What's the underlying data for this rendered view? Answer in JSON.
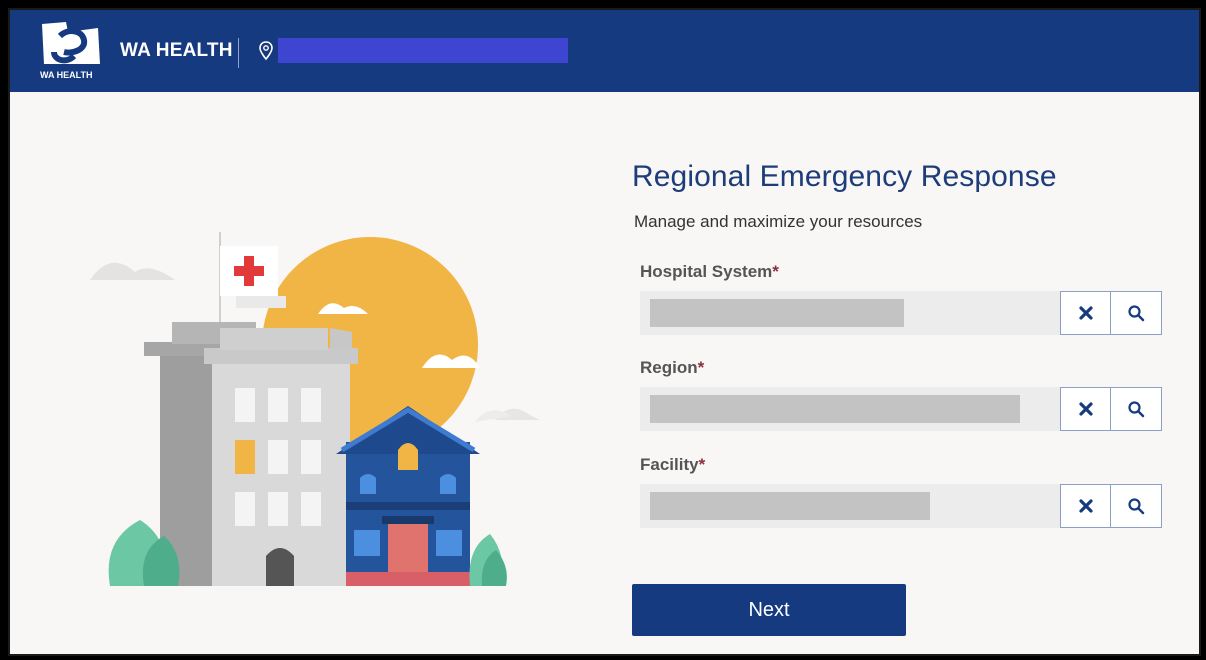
{
  "header": {
    "logo_caption": "WA HEALTH",
    "brand_name": "WA HEALTH",
    "location_value": ""
  },
  "main": {
    "title": "Regional Emergency Response",
    "subtitle": "Manage and maximize your resources",
    "fields": [
      {
        "label": "Hospital System",
        "required_mark": "*",
        "value": ""
      },
      {
        "label": "Region",
        "required_mark": "*",
        "value": ""
      },
      {
        "label": "Facility",
        "required_mark": "*",
        "value": ""
      }
    ],
    "next_label": "Next"
  },
  "icons": [
    "location-pin-icon",
    "clear-icon",
    "search-icon"
  ],
  "colors": {
    "header_bg": "#163a80",
    "title": "#1d3c7a",
    "required": "#8b2c3f",
    "button_bg": "#163a80"
  }
}
